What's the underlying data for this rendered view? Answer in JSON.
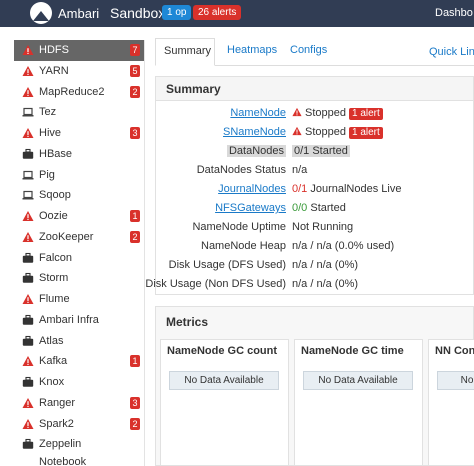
{
  "topbar": {
    "app_name": "Ambari",
    "cluster_name": "Sandbox",
    "ops_badge": "1 op",
    "alerts_badge": "26 alerts",
    "nav_dashboard": "Dashbo"
  },
  "sidebar": {
    "items": [
      {
        "label": "HDFS",
        "icon": "warning-icon",
        "count": "7"
      },
      {
        "label": "YARN",
        "icon": "warning-icon",
        "count": "5"
      },
      {
        "label": "MapReduce2",
        "icon": "warning-icon",
        "count": "2"
      },
      {
        "label": "Tez",
        "icon": "laptop-icon",
        "count": ""
      },
      {
        "label": "Hive",
        "icon": "warning-icon",
        "count": "3"
      },
      {
        "label": "HBase",
        "icon": "briefcase-icon",
        "count": ""
      },
      {
        "label": "Pig",
        "icon": "laptop-icon",
        "count": ""
      },
      {
        "label": "Sqoop",
        "icon": "laptop-icon",
        "count": ""
      },
      {
        "label": "Oozie",
        "icon": "warning-icon",
        "count": "1"
      },
      {
        "label": "ZooKeeper",
        "icon": "warning-icon",
        "count": "2"
      },
      {
        "label": "Falcon",
        "icon": "briefcase-icon",
        "count": ""
      },
      {
        "label": "Storm",
        "icon": "briefcase-icon",
        "count": ""
      },
      {
        "label": "Flume",
        "icon": "warning-icon",
        "count": ""
      },
      {
        "label": "Ambari Infra",
        "icon": "briefcase-icon",
        "count": ""
      },
      {
        "label": "Atlas",
        "icon": "briefcase-icon",
        "count": ""
      },
      {
        "label": "Kafka",
        "icon": "warning-icon",
        "count": "1"
      },
      {
        "label": "Knox",
        "icon": "briefcase-icon",
        "count": ""
      },
      {
        "label": "Ranger",
        "icon": "warning-icon",
        "count": "3"
      },
      {
        "label": "Spark2",
        "icon": "warning-icon",
        "count": "2"
      },
      {
        "label": "Zeppelin",
        "icon": "briefcase-icon",
        "count": ""
      }
    ],
    "extra_line": "Notebook"
  },
  "tabs": {
    "summary": "Summary",
    "heatmaps": "Heatmaps",
    "configs": "Configs",
    "quick_links": "Quick Link"
  },
  "summary": {
    "heading": "Summary",
    "rows": [
      {
        "label": "NameNode",
        "value": "Stopped",
        "alert": "1 alert"
      },
      {
        "label": "SNameNode",
        "value": "Stopped",
        "alert": "1 alert"
      },
      {
        "label": "DataNodes",
        "value": "0/1 Started"
      },
      {
        "label": "DataNodes Status",
        "value": "n/a"
      },
      {
        "label": "JournalNodes",
        "value_prefix": "0/1",
        "value": " JournalNodes Live"
      },
      {
        "label": "NFSGateways",
        "value_prefix": "0/0",
        "value": " Started"
      },
      {
        "label": "NameNode Uptime",
        "value": "Not Running"
      },
      {
        "label": "NameNode Heap",
        "value": "n/a / n/a (0.0% used)"
      },
      {
        "label": "Disk Usage (DFS Used)",
        "value": "n/a / n/a (0%)"
      },
      {
        "label": "Disk Usage (Non DFS Used)",
        "value": "n/a / n/a (0%)"
      }
    ]
  },
  "metrics": {
    "heading": "Metrics",
    "cards": [
      {
        "title": "NameNode GC count",
        "state": "No Data Available"
      },
      {
        "title": "NameNode GC time",
        "state": "No Data Available"
      },
      {
        "title": "NN Conne",
        "state": "No"
      }
    ]
  },
  "colors": {
    "topbar": "#313d54",
    "alert": "#d9312b",
    "ops": "#1e88d6",
    "link": "#1a7ac8",
    "active_service": "#666666"
  }
}
